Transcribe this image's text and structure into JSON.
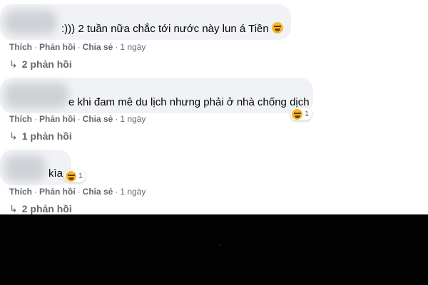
{
  "comments": [
    {
      "text": ":))) 2 tuần nữa chắc tới nước này lun á Tiền",
      "actions": {
        "like": "Thích",
        "reply": "Phản hồi",
        "share": "Chia sẻ",
        "time": "1 ngày"
      },
      "replies_label": "2 phản hồi"
    },
    {
      "text": "e khi đam mê du lịch nhưng phải ở nhà chống dịch",
      "reaction_count": "1",
      "actions": {
        "like": "Thích",
        "reply": "Phản hồi",
        "share": "Chia sẻ",
        "time": "1 ngày"
      },
      "replies_label": "1 phản hồi"
    },
    {
      "text": "kìa",
      "reaction_count": "1",
      "actions": {
        "like": "Thích",
        "reply": "Phản hồi",
        "share": "Chia sẻ",
        "time": "1 ngày"
      },
      "replies_label": "2 phản hồi"
    }
  ],
  "separator": "·",
  "arrow_glyph": "↳",
  "icons": {
    "laugh": "laughing-emoji-icon",
    "reply_arrow": "reply-arrow-icon"
  },
  "colors": {
    "bubble": "#f0f2f5",
    "meta_text": "#65676b",
    "emoji": "#f7b928",
    "bottom_panel": "#020202"
  }
}
